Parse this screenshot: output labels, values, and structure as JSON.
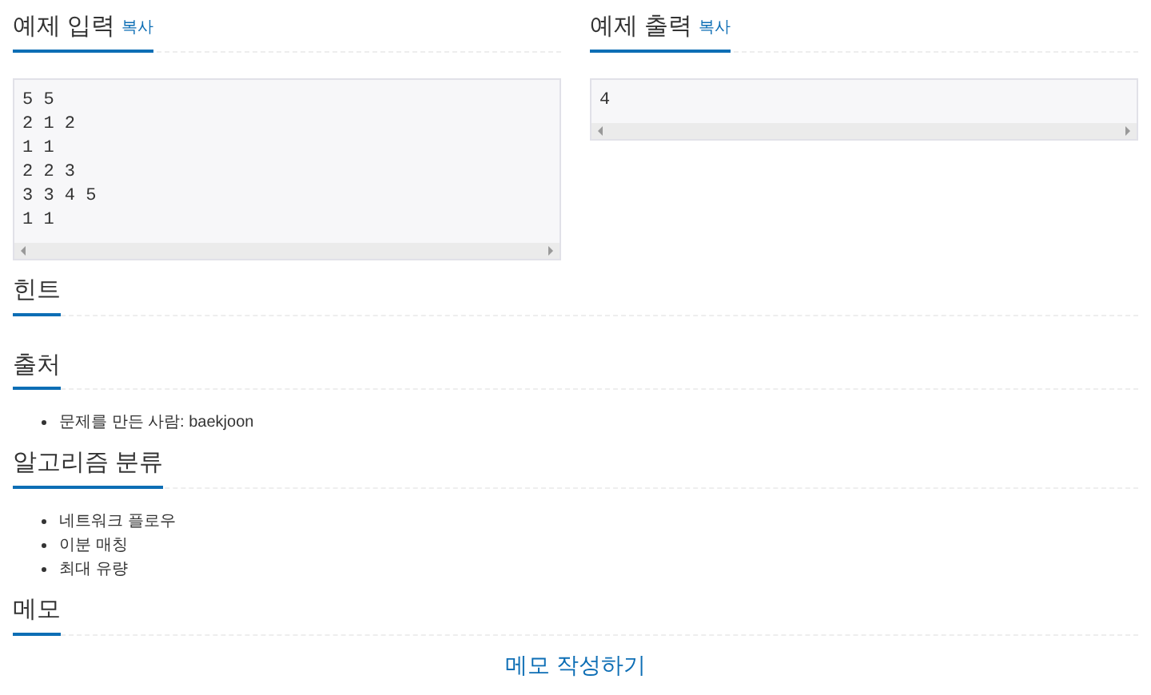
{
  "examples": [
    {
      "title": "예제 입력",
      "copy": "복사",
      "text": "5 5\n2 1 2\n1 1\n2 2 3\n3 3 4 5\n1 1"
    },
    {
      "title": "예제 출력",
      "copy": "복사",
      "text": "4"
    }
  ],
  "sections": [
    {
      "title": "힌트"
    },
    {
      "title": "출처",
      "items": [
        "문제를 만든 사람: baekjoon"
      ]
    },
    {
      "title": "알고리즘 분류",
      "items": [
        "네트워크 플로우",
        "이분 매칭",
        "최대 유량"
      ]
    },
    {
      "title": "메모"
    }
  ],
  "memo_link": "메모 작성하기"
}
